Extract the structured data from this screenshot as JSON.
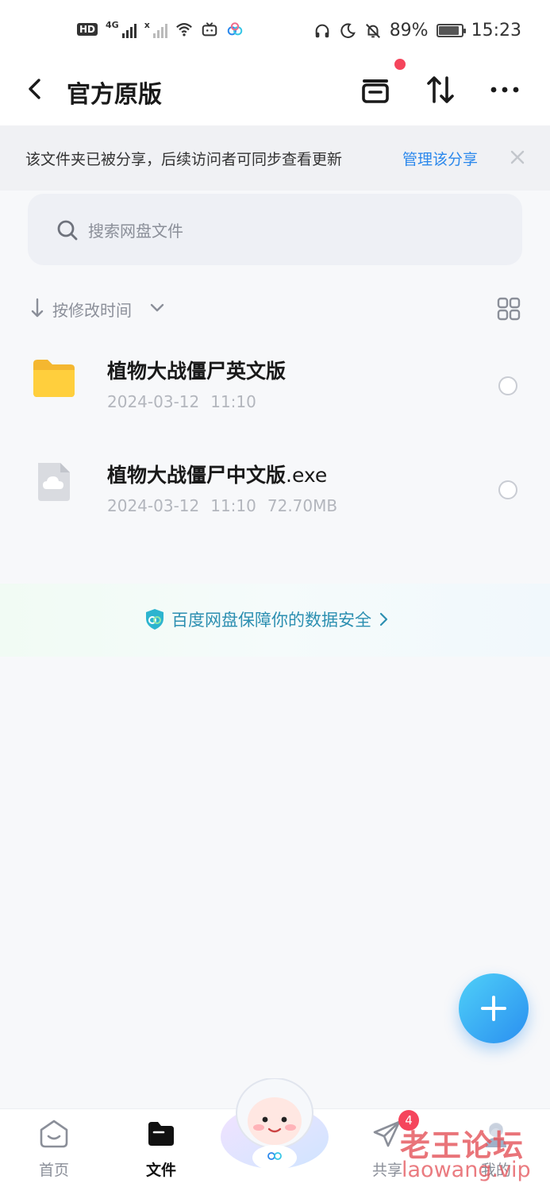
{
  "status_bar": {
    "hd": "HD",
    "net_left": "4G",
    "net_right": "x",
    "battery_pct": "89%",
    "battery_level": 0.89,
    "time": "15:23"
  },
  "header": {
    "title": "官方原版"
  },
  "share_banner": {
    "text": "该文件夹已被分享，后续访问者可同步查看更新",
    "link": "管理该分享"
  },
  "search": {
    "placeholder": "搜索网盘文件"
  },
  "sort": {
    "label": "按修改时间"
  },
  "files": [
    {
      "name": "植物大战僵尸英文版",
      "ext": "",
      "date": "2024-03-12",
      "time": "11:10",
      "size": "",
      "icon": "folder-icon"
    },
    {
      "name": "植物大战僵尸中文版",
      "ext": ".exe",
      "date": "2024-03-12",
      "time": "11:10",
      "size": "72.70MB",
      "icon": "cloud-file-icon"
    }
  ],
  "security": {
    "text": "百度网盘保障你的数据安全"
  },
  "tabs": [
    {
      "label": "首页",
      "icon": "home-icon",
      "active": false
    },
    {
      "label": "文件",
      "icon": "folder-tab-icon",
      "active": true
    },
    {
      "label": "共享",
      "icon": "send-icon",
      "active": false,
      "badge": "4"
    },
    {
      "label": "我的",
      "icon": "avatar-icon",
      "active": false
    }
  ],
  "watermark": {
    "cn": "老王论坛",
    "en": "laowang.vip"
  },
  "colors": {
    "accent": "#2b88ec",
    "badge": "#f5455c",
    "security_text": "#2c8fb1"
  }
}
